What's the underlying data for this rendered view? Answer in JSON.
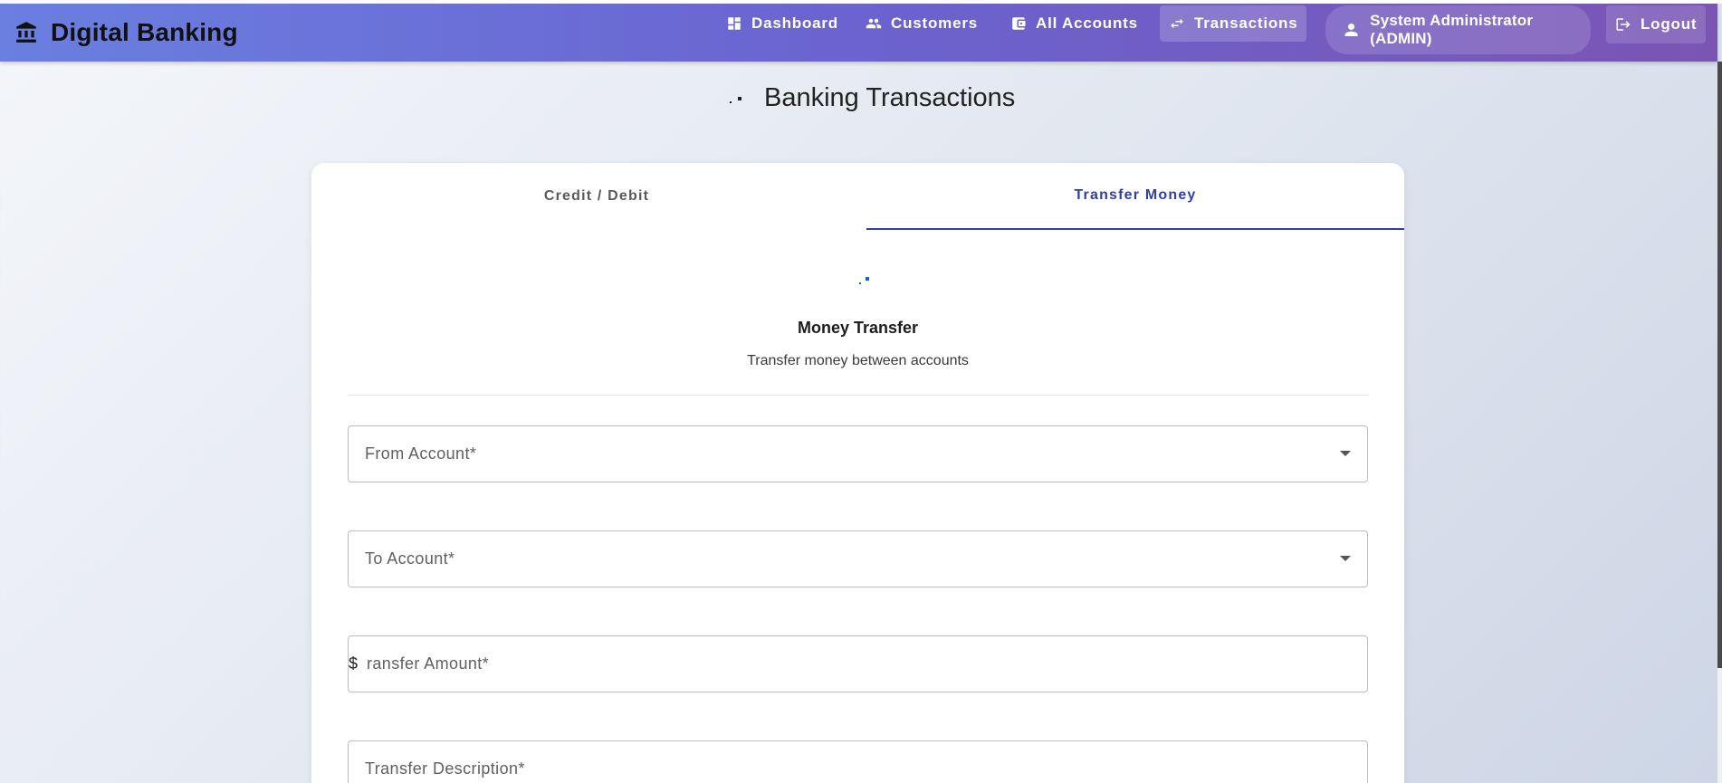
{
  "app": {
    "title": "Digital Banking"
  },
  "nav": {
    "items": [
      {
        "label": "Dashboard",
        "icon": "dashboard-icon"
      },
      {
        "label": "Customers",
        "icon": "people-icon"
      },
      {
        "label": "All Accounts",
        "icon": "wallet-icon"
      },
      {
        "label": "Transactions",
        "icon": "swap-arrows-icon",
        "active": true
      }
    ],
    "user_label": "System Administrator (ADMIN)",
    "logout_label": "Logout"
  },
  "page": {
    "title": "Banking Transactions"
  },
  "tabs": [
    {
      "label": "Credit / Debit",
      "active": false
    },
    {
      "label": "Transfer Money",
      "active": true
    }
  ],
  "transfer": {
    "title": "Money Transfer",
    "subtitle": "Transfer money between accounts",
    "from_account_label": "From Account*",
    "to_account_label": "To Account*",
    "amount_prefix": "$",
    "amount_label": "ransfer Amount*",
    "description_label": "Transfer Description*"
  },
  "colors": {
    "nav_gradient_start": "#6a7fe0",
    "nav_gradient_end": "#7a55b4",
    "active_tab": "#2f3fa8"
  }
}
